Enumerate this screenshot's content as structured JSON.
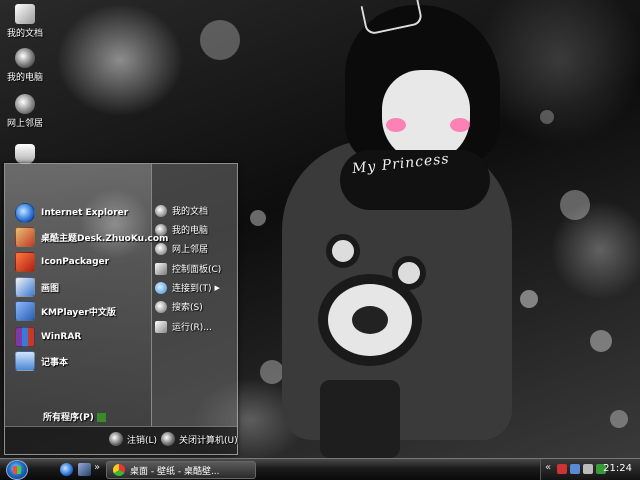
{
  "desktop": {
    "icons": [
      {
        "label": "我的文档",
        "icon": "folder-icon"
      },
      {
        "label": "我的电脑",
        "icon": "computer-icon"
      },
      {
        "label": "网上邻居",
        "icon": "network-icon"
      },
      {
        "label": "",
        "icon": "recycle-bin-icon"
      }
    ],
    "wallpaper_text": "My Princess"
  },
  "start_menu": {
    "programs": [
      {
        "label": "Internet Explorer",
        "icon": "internet-explorer-icon",
        "color": "#2a6fd6"
      },
      {
        "label": "桌酷主题Desk.ZhuoKu.com",
        "icon": "zhuoku-theme-icon",
        "color": "#c43a2a"
      },
      {
        "label": "IconPackager",
        "icon": "iconpackager-icon",
        "color": "#d23a2a"
      },
      {
        "label": "画图",
        "icon": "paint-icon",
        "color": "#3a7ad6"
      },
      {
        "label": "KMPlayer中文版",
        "icon": "kmplayer-icon",
        "color": "#2a5fb0"
      },
      {
        "label": "WinRAR",
        "icon": "winrar-icon",
        "color": "#7a3aa8"
      },
      {
        "label": "记事本",
        "icon": "notepad-icon",
        "color": "#4a8ad6"
      }
    ],
    "all_programs_label": "所有程序(P)",
    "places": [
      {
        "label": "我的文档",
        "icon": "documents-icon",
        "submenu": false
      },
      {
        "label": "我的电脑",
        "icon": "computer-icon",
        "submenu": false
      },
      {
        "label": "网上邻居",
        "icon": "network-icon",
        "submenu": false
      },
      {
        "label": "控制面板(C)",
        "icon": "control-panel-icon",
        "submenu": false
      },
      {
        "label": "连接到(T)",
        "icon": "connect-to-icon",
        "submenu": true
      },
      {
        "label": "搜索(S)",
        "icon": "search-icon",
        "submenu": false
      },
      {
        "label": "运行(R)...",
        "icon": "run-icon",
        "submenu": false
      }
    ],
    "logoff_label": "注销(L)",
    "shutdown_label": "关闭计算机(U)"
  },
  "taskbar": {
    "task_label": "桌面 - 壁纸 - 桌酷壁...",
    "clock": "21:24"
  }
}
